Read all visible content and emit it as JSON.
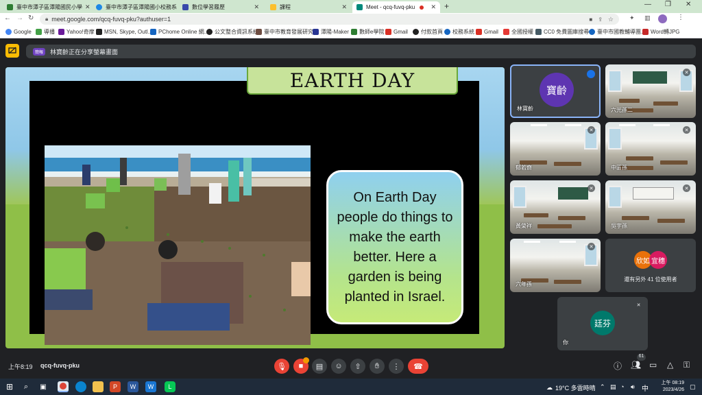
{
  "browser": {
    "tabs": [
      {
        "label": "臺中市潭子區潭陽國民小學",
        "color": "#2e7d32"
      },
      {
        "label": "臺中市潭子區潭陽國小校務系統",
        "color": "#1e88e5"
      },
      {
        "label": "數位學習履歷",
        "color": "#3949ab"
      },
      {
        "label": "課程",
        "color": "#fbc02d"
      },
      {
        "label": "Meet - qcq-fuvq-pku",
        "color": "#00897b"
      }
    ],
    "url": "meet.google.com/qcq-fuvq-pku?authuser=1",
    "bookmarks": [
      {
        "label": "Google",
        "color": "#4285f4"
      },
      {
        "label": "導播",
        "color": "#43a047"
      },
      {
        "label": "Yahoo!奇摩",
        "color": "#6a1b9a"
      },
      {
        "label": "MSN, Skype, Outl...",
        "color": "#212121"
      },
      {
        "label": "PChome Online 網...",
        "color": "#1565c0"
      },
      {
        "label": "公文整合資訊系統",
        "color": "#212121"
      },
      {
        "label": "臺中市教育發展研究...",
        "color": "#6d4c41"
      },
      {
        "label": "潭陽-Maker",
        "color": "#283593"
      },
      {
        "label": "數師e學院",
        "color": "#2e7d32"
      },
      {
        "label": "Gmail",
        "color": "#d93025"
      },
      {
        "label": "付款首頁",
        "color": "#212121"
      },
      {
        "label": "校務系統",
        "color": "#1565c0"
      },
      {
        "label": "Gmail",
        "color": "#d93025"
      },
      {
        "label": "全國授權",
        "color": "#e53935"
      },
      {
        "label": "CC0 免費圖庫搜尋...",
        "color": "#455a64"
      },
      {
        "label": "臺中市國教輔導團...",
        "color": "#1565c0"
      },
      {
        "label": "Word轉JPG",
        "color": "#c62828"
      }
    ]
  },
  "meet": {
    "banner_badge": "簡報",
    "banner_text": "林寶齡正在分享螢幕畫面",
    "slide": {
      "title": "EARTH DAY",
      "body": "On Earth Day people do things to make the earth better. Here a garden is being planted in Israel."
    },
    "participants": [
      {
        "name": "林寶齡",
        "avatar_text": "寶齡",
        "avatar_color": "#5e35b1"
      },
      {
        "name": "六光孫二"
      },
      {
        "name": "郁若齋"
      },
      {
        "name": "中區孫"
      },
      {
        "name": "黃榮祥"
      },
      {
        "name": "吳宇孫"
      },
      {
        "name": "六年孫"
      },
      {
        "name": "你",
        "avatar_text": "廷芬",
        "avatar_color": "#00796b"
      }
    ],
    "others": {
      "avatars": [
        {
          "text": "欣如",
          "color": "#e8710a"
        },
        {
          "text": "宜穗",
          "color": "#d81b60"
        }
      ],
      "label": "還有另外 41 位使用者"
    },
    "time": "上午8:19",
    "meeting_code": "qcq-fuvq-pku",
    "people_count": "61"
  },
  "taskbar": {
    "weather": "19°C 多雲時晴",
    "clock_time": "上午 08:19",
    "clock_date": "2023/4/26",
    "ime": "中"
  }
}
